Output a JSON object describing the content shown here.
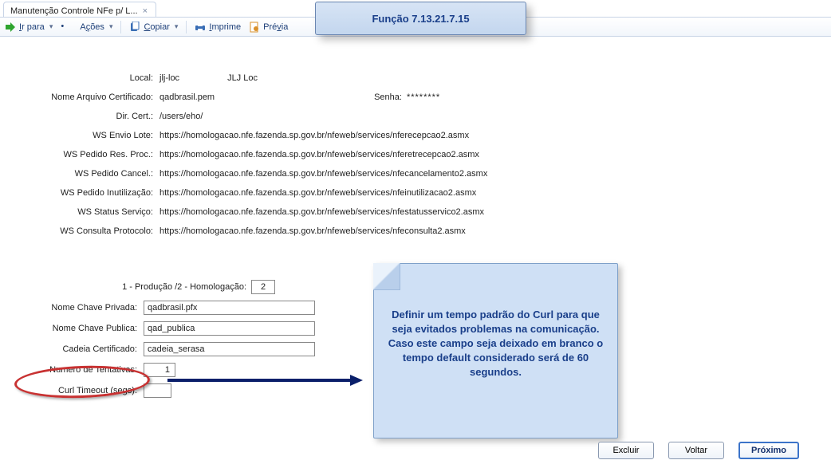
{
  "tab": {
    "title": "Manutenção Controle NFe p/ L..."
  },
  "toolbar": {
    "ir_para": "Ir para",
    "acoes": "Ações",
    "copiar": "Copiar",
    "imprime": "Imprime",
    "previa": "Prévia"
  },
  "badge": {
    "text": "Função 7.13.21.7.15"
  },
  "fields": {
    "local_label": "Local:",
    "local_value": "jlj-loc",
    "local_extra": "JLJ Loc",
    "nome_arq_cert_label": "Nome Arquivo Certificado:",
    "nome_arq_cert_value": "qadbrasil.pem",
    "senha_label": "Senha:",
    "senha_value": "********",
    "dir_cert_label": "Dir. Cert.:",
    "dir_cert_value": "/users/eho/",
    "ws_envio_label": "WS Envio Lote:",
    "ws_envio_value": "https://homologacao.nfe.fazenda.sp.gov.br/nfeweb/services/nferecepcao2.asmx",
    "ws_pedido_res_label": "WS Pedido Res. Proc.:",
    "ws_pedido_res_value": "https://homologacao.nfe.fazenda.sp.gov.br/nfeweb/services/nferetrecepcao2.asmx",
    "ws_pedido_cancel_label": "WS Pedido Cancel.:",
    "ws_pedido_cancel_value": "https://homologacao.nfe.fazenda.sp.gov.br/nfeweb/services/nfecancelamento2.asmx",
    "ws_pedido_inut_label": "WS Pedido Inutilização:",
    "ws_pedido_inut_value": "https://homologacao.nfe.fazenda.sp.gov.br/nfeweb/services/nfeinutilizacao2.asmx",
    "ws_status_label": "WS Status Serviço:",
    "ws_status_value": "https://homologacao.nfe.fazenda.sp.gov.br/nfeweb/services/nfestatusservico2.asmx",
    "ws_consulta_label": "WS Consulta Protocolo:",
    "ws_consulta_value": "https://homologacao.nfe.fazenda.sp.gov.br/nfeweb/services/nfeconsulta2.asmx"
  },
  "block2": {
    "prod_hom_label": "1 - Produção /2 - Homologação:",
    "prod_hom_value": "2",
    "chave_priv_label": "Nome Chave Privada:",
    "chave_priv_value": "qadbrasil.pfx",
    "chave_pub_label": "Nome Chave Publica:",
    "chave_pub_value": "qad_publica",
    "cadeia_label": "Cadeia Certificado:",
    "cadeia_value": "cadeia_serasa",
    "tentativas_label": "Numero de Tentativas:",
    "tentativas_value": "1",
    "curl_label": "Curl Timeout (segs):",
    "curl_value": ""
  },
  "note": {
    "text": "Definir um tempo padrão do Curl para que seja evitados problemas na comunicação. Caso este campo seja deixado em branco o tempo default considerado será de 60 segundos."
  },
  "buttons": {
    "excluir": "Excluir",
    "voltar": "Voltar",
    "proximo": "Próximo"
  }
}
